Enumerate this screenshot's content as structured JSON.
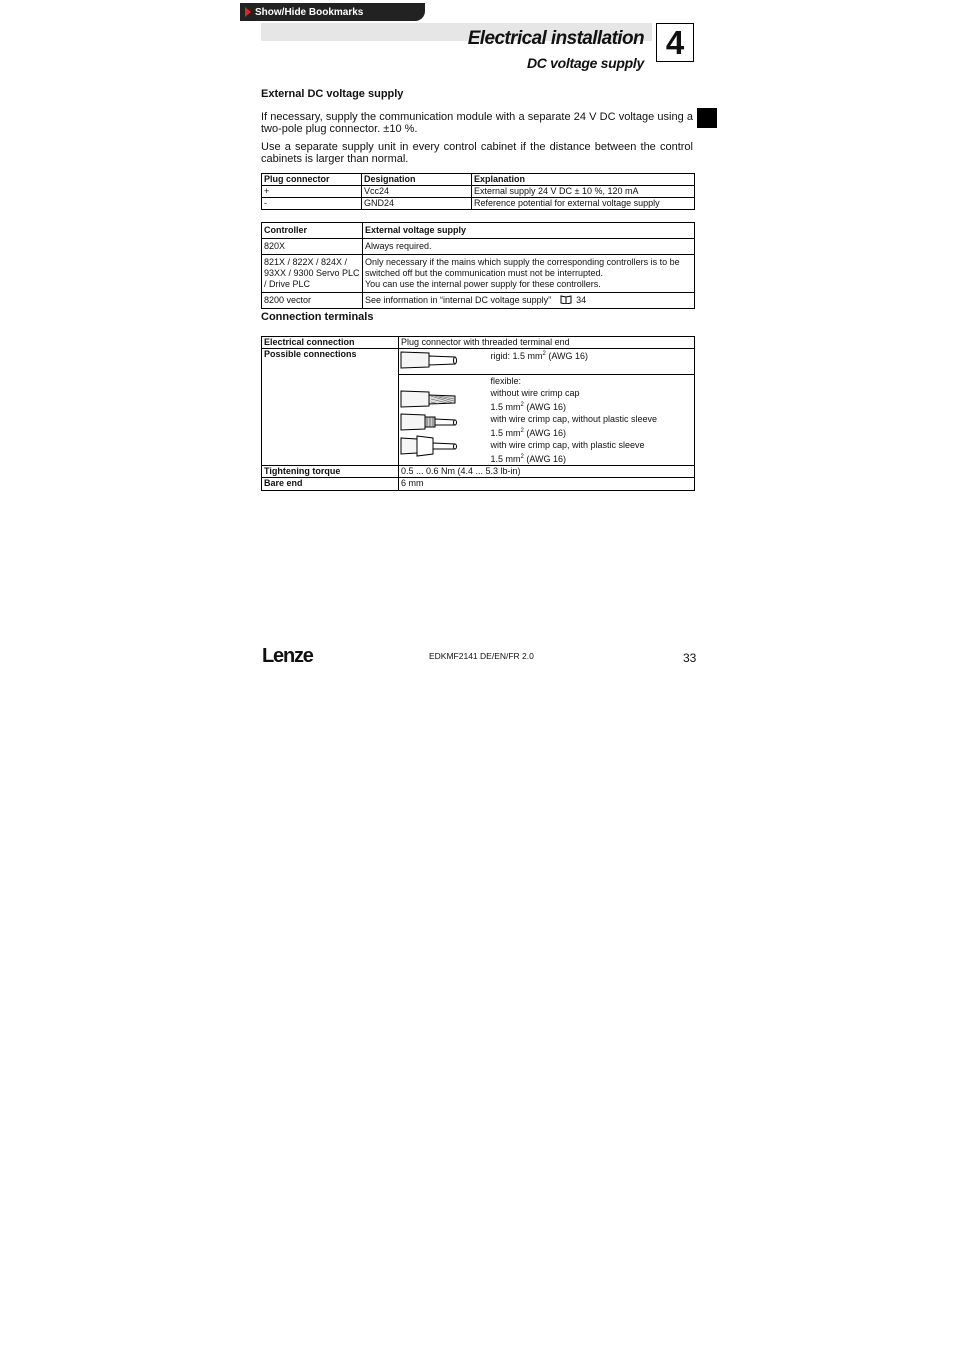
{
  "bookmark_tab": {
    "label": "Show/Hide Bookmarks"
  },
  "header": {
    "title": "Electrical installation",
    "subtitle": "DC voltage supply",
    "chapter_number": "4"
  },
  "section1": {
    "heading": "External DC voltage supply",
    "para1": "If necessary, supply the communication module with a separate 24 V DC  voltage using a two-pole plug connector. ±10 %.",
    "para2": "Use a separate supply unit in every control cabinet if the distance between the control cabinets is larger than normal."
  },
  "plug_table": {
    "headers": [
      "Plug connector",
      "Designation",
      "Explanation"
    ],
    "rows": [
      [
        "+",
        "Vcc24",
        "External supply 24 V DC ± 10 %, 120 mA"
      ],
      [
        "-",
        "GND24",
        "Reference potential for external voltage supply"
      ]
    ]
  },
  "controller_table": {
    "headers": [
      "Controller",
      "External voltage supply"
    ],
    "rows": [
      [
        "820X",
        "Always required."
      ],
      [
        "821X / 822X / 824X / 93XX / 9300 Servo PLC / Drive PLC",
        "Only necessary if the mains which supply the corresponding controllers is to be switched off but the communication must not be interrupted.",
        "You can use the internal power supply for these controllers."
      ],
      [
        "8200 vector",
        "See information in “internal DC voltage supply”",
        "34"
      ]
    ]
  },
  "section2": {
    "heading": "Connection terminals"
  },
  "terminal_table": {
    "electrical_connection": {
      "label": "Electrical connection",
      "value": "Plug connector with threaded terminal end"
    },
    "possible_connections": {
      "label": "Possible connections",
      "rigid": "rigid: 1.5 mm",
      "rigid_sup": "2",
      "rigid_awg": " (AWG 16)",
      "flexible": "flexible:",
      "without_cap": "without wire crimp cap",
      "with_cap_no_sleeve": "with wire crimp cap, without plastic sleeve",
      "with_cap_sleeve": "with wire crimp cap, with plastic sleeve",
      "size": "1.5 mm",
      "size_sup": "2",
      "size_awg": " (AWG 16)"
    },
    "tightening_torque": {
      "label": "Tightening torque",
      "value": "0.5 ... 0.6 Nm (4.4 ... 5.3 lb-in)"
    },
    "bare_end": {
      "label": "Bare end",
      "value": "6 mm"
    }
  },
  "footer": {
    "logo": "Lenze",
    "doc_code": "EDKMF2141 DE/EN/FR 2.0",
    "page_number": "33"
  },
  "colors": {
    "accent_red": "#e0261d",
    "header_gray": "#e6e6e6",
    "tab_dark": "#222222"
  },
  "icons": [
    "play-triangle-icon",
    "book-icon",
    "rigid-wire-icon",
    "stranded-wire-icon",
    "crimp-ferrule-icon",
    "insulated-ferrule-icon"
  ]
}
